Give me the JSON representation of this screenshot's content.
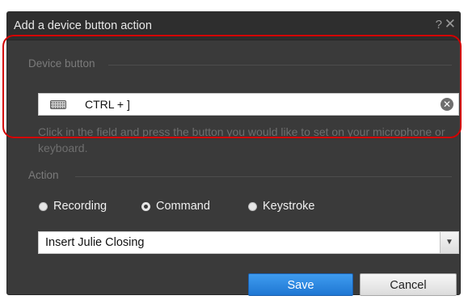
{
  "dialog": {
    "title": "Add a device button action",
    "help_glyph": "?",
    "close_glyph": "✕"
  },
  "device_button": {
    "section_label": "Device button",
    "key_value": "CTRL + ]",
    "clear_glyph": "✕",
    "hint": "Click in the field and press the button you would like to set on your microphone or keyboard."
  },
  "action": {
    "section_label": "Action",
    "options": [
      {
        "label": "Recording",
        "selected": false
      },
      {
        "label": "Command",
        "selected": true
      },
      {
        "label": "Keystroke",
        "selected": false
      }
    ],
    "dropdown_value": "Insert Julie Closing",
    "dropdown_arrow": "▼"
  },
  "buttons": {
    "save_label": "Save",
    "cancel_label": "Cancel"
  },
  "colors": {
    "dialog_bg": "#3a3a3a",
    "highlight": "#d40000",
    "save_button": "#2a86e0"
  }
}
